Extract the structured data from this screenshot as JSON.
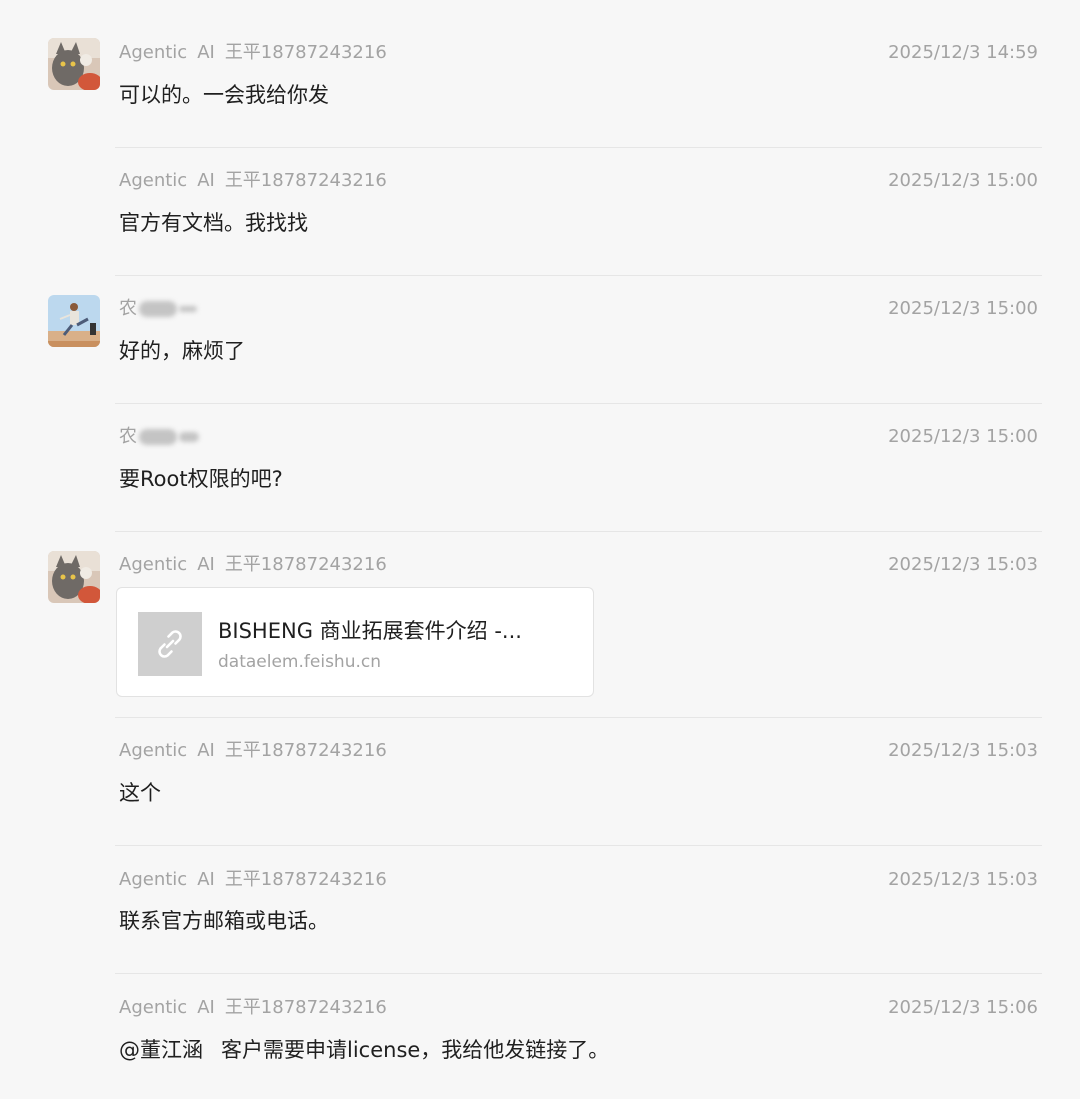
{
  "messages": [
    {
      "sender": "Agentic AI 王平18787243216",
      "sender_parts": [
        "Agentic",
        "AI",
        "王平18787243216"
      ],
      "time": "2025/12/3 14:59",
      "text": "可以的。一会我给你发",
      "avatar": "cat-photo"
    },
    {
      "sender_parts": [
        "Agentic",
        "AI",
        "王平18787243216"
      ],
      "time": "2025/12/3 15:00",
      "text": "官方有文档。我找找"
    },
    {
      "sender_visible": "农",
      "time": "2025/12/3 15:00",
      "text": "好的，麻烦了",
      "avatar": "person-photo"
    },
    {
      "sender_visible": "农",
      "time": "2025/12/3 15:00",
      "text": "要Root权限的吧?"
    },
    {
      "sender_parts": [
        "Agentic",
        "AI",
        "王平18787243216"
      ],
      "time": "2025/12/3 15:03",
      "avatar": "cat-photo",
      "link_card": {
        "title": "BISHENG 商业拓展套件介绍 -...",
        "domain": "dataelem.feishu.cn",
        "icon": "link-icon"
      }
    },
    {
      "sender_parts": [
        "Agentic",
        "AI",
        "王平18787243216"
      ],
      "time": "2025/12/3 15:03",
      "text": "这个"
    },
    {
      "sender_parts": [
        "Agentic",
        "AI",
        "王平18787243216"
      ],
      "time": "2025/12/3 15:03",
      "text": "联系官方邮箱或电话。"
    },
    {
      "sender_parts": [
        "Agentic",
        "AI",
        "王平18787243216"
      ],
      "time": "2025/12/3 15:06",
      "mention": "@董江涵",
      "text": "客户需要申请license，我给他发链接了。"
    }
  ],
  "colors": {
    "background": "#f7f7f7",
    "meta_text": "#a3a3a3",
    "body_text": "#1f1f1f",
    "divider": "#e6e6e6"
  }
}
